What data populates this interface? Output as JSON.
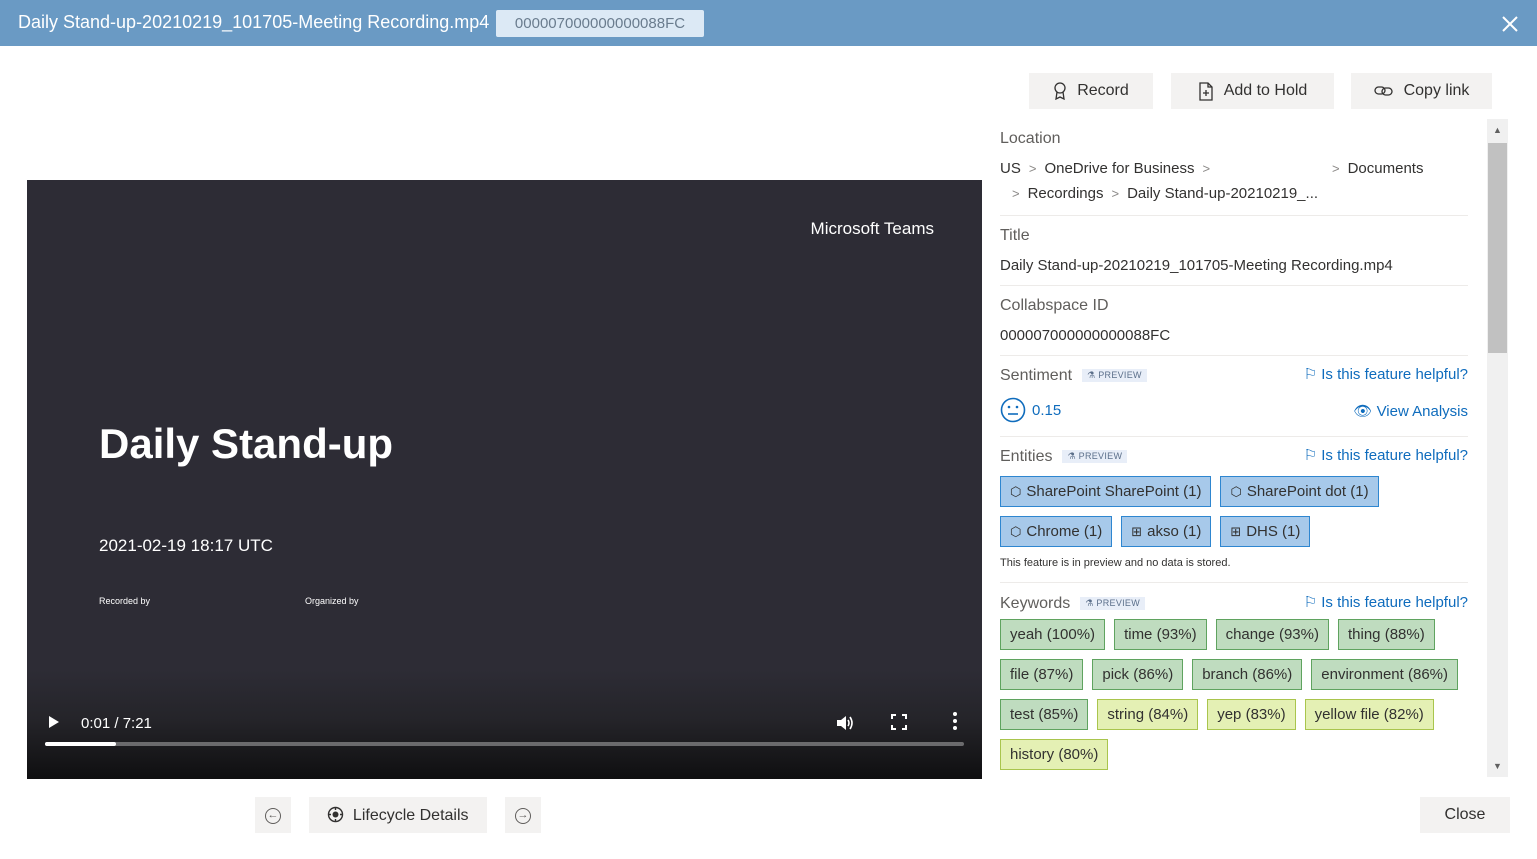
{
  "header": {
    "title": "Daily Stand-up-20210219_101705-Meeting Recording.mp4",
    "id_badge": "000007000000000088FC",
    "close_icon": "close-icon"
  },
  "actions": {
    "record_label": "Record",
    "hold_label": "Add to Hold",
    "copy_label": "Copy link"
  },
  "video": {
    "brand": "Microsoft Teams",
    "slide_title": "Daily Stand-up",
    "slide_date": "2021-02-19 18:17 UTC",
    "recorded_by": "Recorded by",
    "organized_by": "Organized by",
    "time": "0:01 / 7:21",
    "progress_fraction": 0.077
  },
  "location": {
    "label": "Location",
    "crumbs_line1": [
      "US",
      "OneDrive for Business",
      "Documents"
    ],
    "crumbs_line2": [
      "Recordings",
      "Daily Stand-up-20210219_..."
    ]
  },
  "title_field": {
    "label": "Title",
    "value": "Daily Stand-up-20210219_101705-Meeting Recording.mp4"
  },
  "collabspace": {
    "label": "Collabspace ID",
    "value": "000007000000000088FC"
  },
  "sentiment": {
    "label": "Sentiment",
    "preview": "PREVIEW",
    "helpful": "Is this feature helpful?",
    "score": "0.15",
    "view_analysis": "View Analysis"
  },
  "entities": {
    "label": "Entities",
    "preview": "PREVIEW",
    "helpful": "Is this feature helpful?",
    "items": [
      {
        "label": "SharePoint SharePoint (1)",
        "icon": "cube-icon"
      },
      {
        "label": "SharePoint dot (1)",
        "icon": "cube-icon"
      },
      {
        "label": "Chrome (1)",
        "icon": "cube-icon"
      },
      {
        "label": "akso (1)",
        "icon": "org-chart-icon"
      },
      {
        "label": "DHS (1)",
        "icon": "org-chart-icon"
      }
    ],
    "note": "This feature is in preview and no data is stored."
  },
  "keywords": {
    "label": "Keywords",
    "preview": "PREVIEW",
    "helpful": "Is this feature helpful?",
    "items": [
      {
        "label": "yeah (100%)",
        "tone": "green"
      },
      {
        "label": "time (93%)",
        "tone": "green"
      },
      {
        "label": "change (93%)",
        "tone": "green"
      },
      {
        "label": "thing (88%)",
        "tone": "green"
      },
      {
        "label": "file (87%)",
        "tone": "green"
      },
      {
        "label": "pick (86%)",
        "tone": "green"
      },
      {
        "label": "branch (86%)",
        "tone": "green"
      },
      {
        "label": "environment (86%)",
        "tone": "green"
      },
      {
        "label": "test (85%)",
        "tone": "green"
      },
      {
        "label": "string (84%)",
        "tone": "yellow"
      },
      {
        "label": "yep (83%)",
        "tone": "yellow"
      },
      {
        "label": "yellow file (82%)",
        "tone": "yellow"
      },
      {
        "label": "history (80%)",
        "tone": "yellow"
      }
    ]
  },
  "footer": {
    "lifecycle_label": "Lifecycle Details",
    "close_label": "Close"
  }
}
